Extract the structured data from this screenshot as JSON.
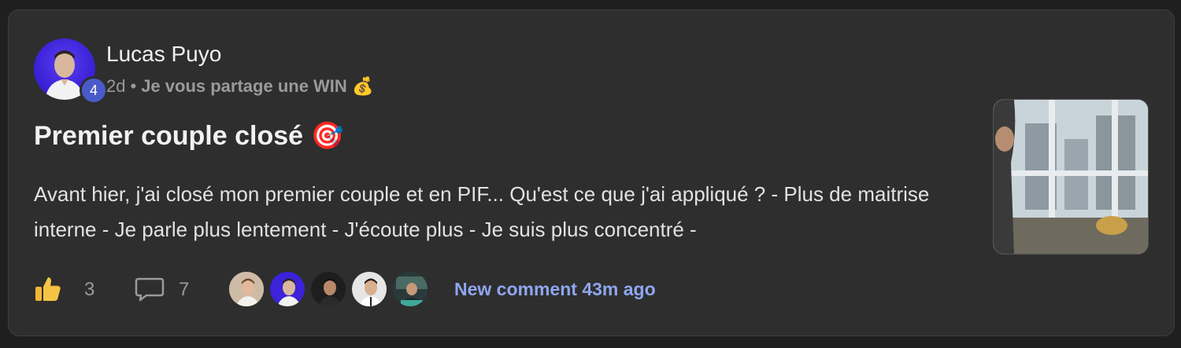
{
  "post": {
    "author": {
      "name": "Lucas Puyo",
      "level": "4"
    },
    "meta": {
      "age": "2d",
      "separator": "•",
      "category": "Je vous partage une WIN",
      "category_emoji": "💰"
    },
    "title": "Premier couple closé",
    "title_emoji": "🎯",
    "excerpt": "Avant hier, j'ai closé mon premier couple et en PIF... Qu'est ce que j'ai appliqué ? - Plus de maitrise interne - Je parle plus lentement - J'écoute plus - Je suis plus concentré -",
    "thumbnail_icon": "office-window-photo",
    "footer": {
      "like_icon": "thumbs-up-icon",
      "likes": "3",
      "comment_icon": "speech-bubble-icon",
      "comments": "7",
      "commenter_avatars": [
        "avatar-1",
        "avatar-2",
        "avatar-3",
        "avatar-4",
        "avatar-5"
      ],
      "new_comment_label": "New comment 43m ago"
    }
  },
  "colors": {
    "background": "#1f1f1f",
    "card": "#2e2e2e",
    "link": "#8fa6f0",
    "level_badge": "#4a5bc9",
    "avatar_blue": "#3c22d8"
  }
}
